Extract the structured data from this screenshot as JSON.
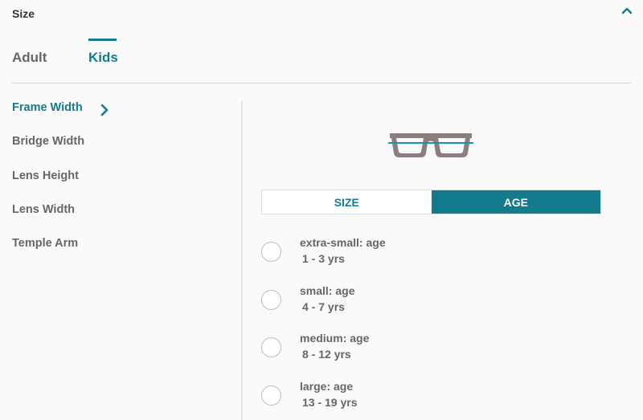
{
  "header": {
    "title": "Size",
    "collapse_icon": "chevron-up-icon"
  },
  "tabs": [
    {
      "label": "Adult",
      "active": false
    },
    {
      "label": "Kids",
      "active": true
    }
  ],
  "sidebar": {
    "items": [
      {
        "label": "Frame Width",
        "active": true
      },
      {
        "label": "Bridge Width",
        "active": false
      },
      {
        "label": "Lens Height",
        "active": false
      },
      {
        "label": "Lens Width",
        "active": false
      },
      {
        "label": "Temple Arm",
        "active": false
      }
    ],
    "active_indicator_icon": "chevron-right-icon"
  },
  "illustration": {
    "icon": "glasses-frame-width-icon"
  },
  "toggle": {
    "options": [
      "SIZE",
      "AGE"
    ],
    "selected": "AGE"
  },
  "options": [
    {
      "label": "extra-small: age",
      "range": "1 - 3 yrs",
      "selected": false
    },
    {
      "label": "small: age",
      "range": "4 - 7 yrs",
      "selected": false
    },
    {
      "label": "medium: age",
      "range": "8 - 12 yrs",
      "selected": false
    },
    {
      "label": "large: age",
      "range": "13 - 19 yrs",
      "selected": false
    }
  ],
  "colors": {
    "accent": "#137b8b",
    "text": "#666666",
    "frame": "#8a7f7c",
    "background": "#fafafa"
  }
}
